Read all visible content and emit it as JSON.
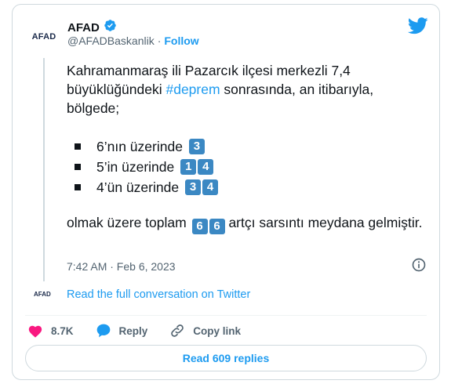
{
  "author": {
    "avatar_text_a": "AFAD",
    "name": "AFAD",
    "verified_icon": "verified-badge-icon",
    "handle": "@AFADBaskanlik",
    "separator": "·",
    "follow_label": "Follow"
  },
  "tweet": {
    "line1_pre": "Kahramanmaraş ili Pazarcık ilçesi merkezli 7,4 büyüklüğündeki ",
    "hashtag": "#deprem",
    "line1_post": " sonrasında, an itibarıyla, bölgede;",
    "bullets": [
      {
        "text": "6’nın üzerinde",
        "digits": [
          "3"
        ]
      },
      {
        "text": "5’in üzerinde",
        "digits": [
          "1",
          "4"
        ]
      },
      {
        "text": "4’ün üzerinde",
        "digits": [
          "3",
          "4"
        ]
      }
    ],
    "closing_pre": "olmak üzere toplam ",
    "closing_digits": [
      "6",
      "6"
    ],
    "closing_post": " artçı sarsıntı meydana gelmiştir."
  },
  "meta": {
    "timestamp": "7:42 AM · Feb 6, 2023"
  },
  "conversation": {
    "avatar_text": "AFAD",
    "link_label": "Read the full conversation on Twitter"
  },
  "actions": {
    "like_count": "8.7K",
    "reply_label": "Reply",
    "copy_label": "Copy link"
  },
  "footer": {
    "read_replies_label": "Read 609 replies"
  },
  "colors": {
    "accent": "#1d9bf0",
    "like": "#f91880",
    "keycap": "#3b88c3"
  }
}
